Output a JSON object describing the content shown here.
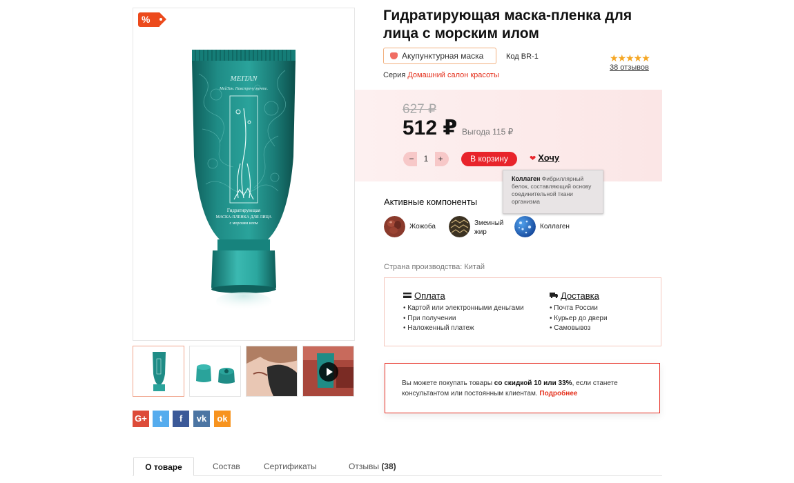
{
  "product": {
    "title": "Гидратирующая маска-пленка для лица с морским илом",
    "effect_label": "Акупунктурная маска",
    "code": "Код BR-1",
    "rating_stars": "★★★★★",
    "rating_value": 4.5,
    "reviews": "38 отзывов",
    "series_prefix": "Серия",
    "series_link": "Домашний салон красоты",
    "sale_badge": "%"
  },
  "price": {
    "old": "627 ₽",
    "current": "512 ₽",
    "savings": "Выгода 115 ₽"
  },
  "cart": {
    "minus": "−",
    "quantity": "1",
    "plus": "+",
    "add_button": "В корзину",
    "wish_label": "Хочу"
  },
  "tooltip": {
    "term": "Коллаген",
    "text": "Фибриллярный белок, составляющий основу соединительной ткани организма"
  },
  "components": {
    "title": "Активные компоненты",
    "items": [
      {
        "label": "Жожоба",
        "icon": "jojoba-icon"
      },
      {
        "label": "Змеиный жир",
        "line1": "Змеиный",
        "line2": "жир",
        "icon": "snake-fat-icon"
      },
      {
        "label": "Коллаген",
        "icon": "collagen-icon"
      }
    ]
  },
  "country": "Страна производства: Китай",
  "payment": {
    "title": "Оплата",
    "items": [
      "• Картой или электронными деньгами",
      "• При получении",
      "• Наложенный платеж"
    ]
  },
  "delivery": {
    "title": "Доставка",
    "items": [
      "• Почта России",
      "• Курьер до двери",
      "• Самовывоз"
    ]
  },
  "promo": {
    "text1": "Вы можете покупать товары ",
    "bold": "со скидкой 10 или 33%",
    "text2": ", если станете консультантом или постоянным клиентам. ",
    "link": "Подробнее"
  },
  "tube_text": {
    "brand": "MEITAN",
    "slogan": "МейТан. Навстречу мечте.",
    "label_line1": "Гидратирующая",
    "label_line2": "МАСКА-ПЛЕНКА ДЛЯ ЛИЦА",
    "label_line3": "с морским илом"
  },
  "thumbs": [
    {
      "name": "thumb-tube"
    },
    {
      "name": "thumb-cap"
    },
    {
      "name": "thumb-face-mask"
    },
    {
      "name": "thumb-video"
    }
  ],
  "share": [
    {
      "name": "google-plus-share",
      "glyph": "G+",
      "color": "#dd4b39"
    },
    {
      "name": "twitter-share",
      "glyph": "t",
      "color": "#55acee"
    },
    {
      "name": "facebook-share",
      "glyph": "f",
      "color": "#3b5998"
    },
    {
      "name": "vk-share",
      "glyph": "vk",
      "color": "#4c75a3"
    },
    {
      "name": "odnoklassniki-share",
      "glyph": "ok",
      "color": "#f7931e"
    }
  ],
  "tabs": [
    {
      "label": "О товаре"
    },
    {
      "label": "Состав"
    },
    {
      "label": "Сертификаты"
    },
    {
      "label": "Отзывы",
      "count": "(38)"
    }
  ],
  "colors": {
    "accent_red": "#e8242b",
    "link_red": "#e42f1b",
    "tube_teal": "#1f8c86",
    "price_bg": "#fdf0f0"
  }
}
